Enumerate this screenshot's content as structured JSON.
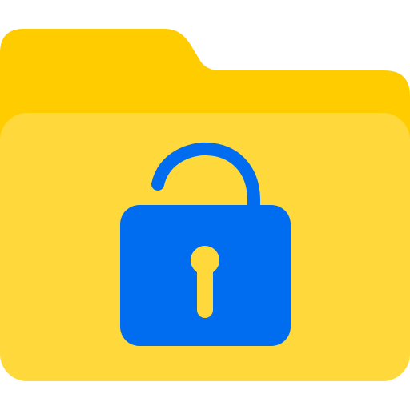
{
  "icon": {
    "name": "unlocked-folder-icon",
    "parts": [
      "folder-back-icon",
      "folder-front-icon",
      "unlocked-padlock-icon"
    ]
  },
  "colors": {
    "background": "#ffffff",
    "folder_back": "#ffcc00",
    "folder_front": "#ffd93b",
    "padlock": "#006df0",
    "keyhole": "#ffd93b"
  }
}
